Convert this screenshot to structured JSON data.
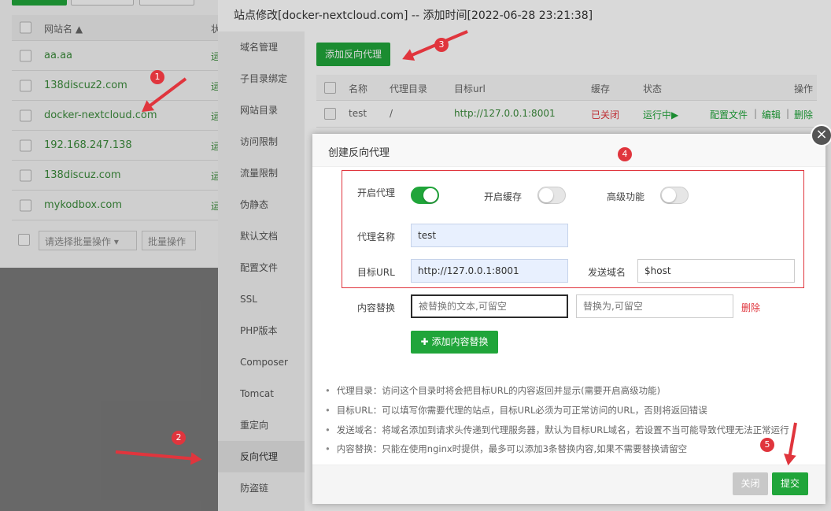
{
  "background": {
    "list_header": {
      "name_label": "网站名 ▲",
      "status_label": "状"
    },
    "sites": [
      {
        "name": "aa.aa",
        "status": "运"
      },
      {
        "name": "138discuz2.com",
        "status": "运"
      },
      {
        "name": "docker-nextcloud.com",
        "status": "运"
      },
      {
        "name": "192.168.247.138",
        "status": "运"
      },
      {
        "name": "138discuz.com",
        "status": "运"
      },
      {
        "name": "mykodbox.com",
        "status": "运"
      }
    ],
    "batch_select_placeholder": "请选择批量操作",
    "batch_button": "批量操作"
  },
  "modal": {
    "title": "站点修改[docker-nextcloud.com] -- 添加时间[2022-06-28 23:21:38]",
    "nav": [
      "域名管理",
      "子目录绑定",
      "网站目录",
      "访问限制",
      "流量限制",
      "伪静态",
      "默认文档",
      "配置文件",
      "SSL",
      "PHP版本",
      "Composer",
      "Tomcat",
      "重定向",
      "反向代理",
      "防盗链"
    ],
    "active_nav": "反向代理",
    "add_proxy_button": "添加反向代理",
    "table": {
      "headers": [
        "名称",
        "代理目录",
        "目标url",
        "缓存",
        "状态",
        "操作"
      ],
      "rows": [
        {
          "name": "test",
          "dir": "/",
          "target": "http://127.0.0.1:8001",
          "cache": "已关闭",
          "status": "运行中▶",
          "actions": [
            "配置文件",
            "编辑",
            "删除"
          ]
        }
      ]
    }
  },
  "dialog": {
    "title": "创建反向代理",
    "enable_proxy_label": "开启代理",
    "enable_proxy": true,
    "enable_cache_label": "开启缓存",
    "enable_cache": false,
    "advanced_label": "高级功能",
    "advanced": false,
    "proxy_name_label": "代理名称",
    "proxy_name_value": "test",
    "target_url_label": "目标URL",
    "target_url_value": "http://127.0.0.1:8001",
    "send_domain_label": "发送域名",
    "send_domain_value": "$host",
    "content_replace_label": "内容替换",
    "replace_from_placeholder": "被替换的文本,可留空",
    "replace_to_placeholder": "替换为,可留空",
    "delete_label": "删除",
    "add_replace_button": "添加内容替换",
    "tips": [
      "代理目录：访问这个目录时将会把目标URL的内容返回并显示(需要开启高级功能)",
      "目标URL：可以填写你需要代理的站点，目标URL必须为可正常访问的URL，否则将返回错误",
      "发送域名：将域名添加到请求头传递到代理服务器，默认为目标URL域名，若设置不当可能导致代理无法正常运行",
      "内容替换：只能在使用nginx时提供，最多可以添加3条替换内容,如果不需要替换请留空"
    ],
    "close_button": "关闭",
    "submit_button": "提交"
  },
  "annotations": [
    "1",
    "2",
    "3",
    "4",
    "5"
  ],
  "colors": {
    "accent": "#20a53a",
    "danger": "#e0353d"
  }
}
